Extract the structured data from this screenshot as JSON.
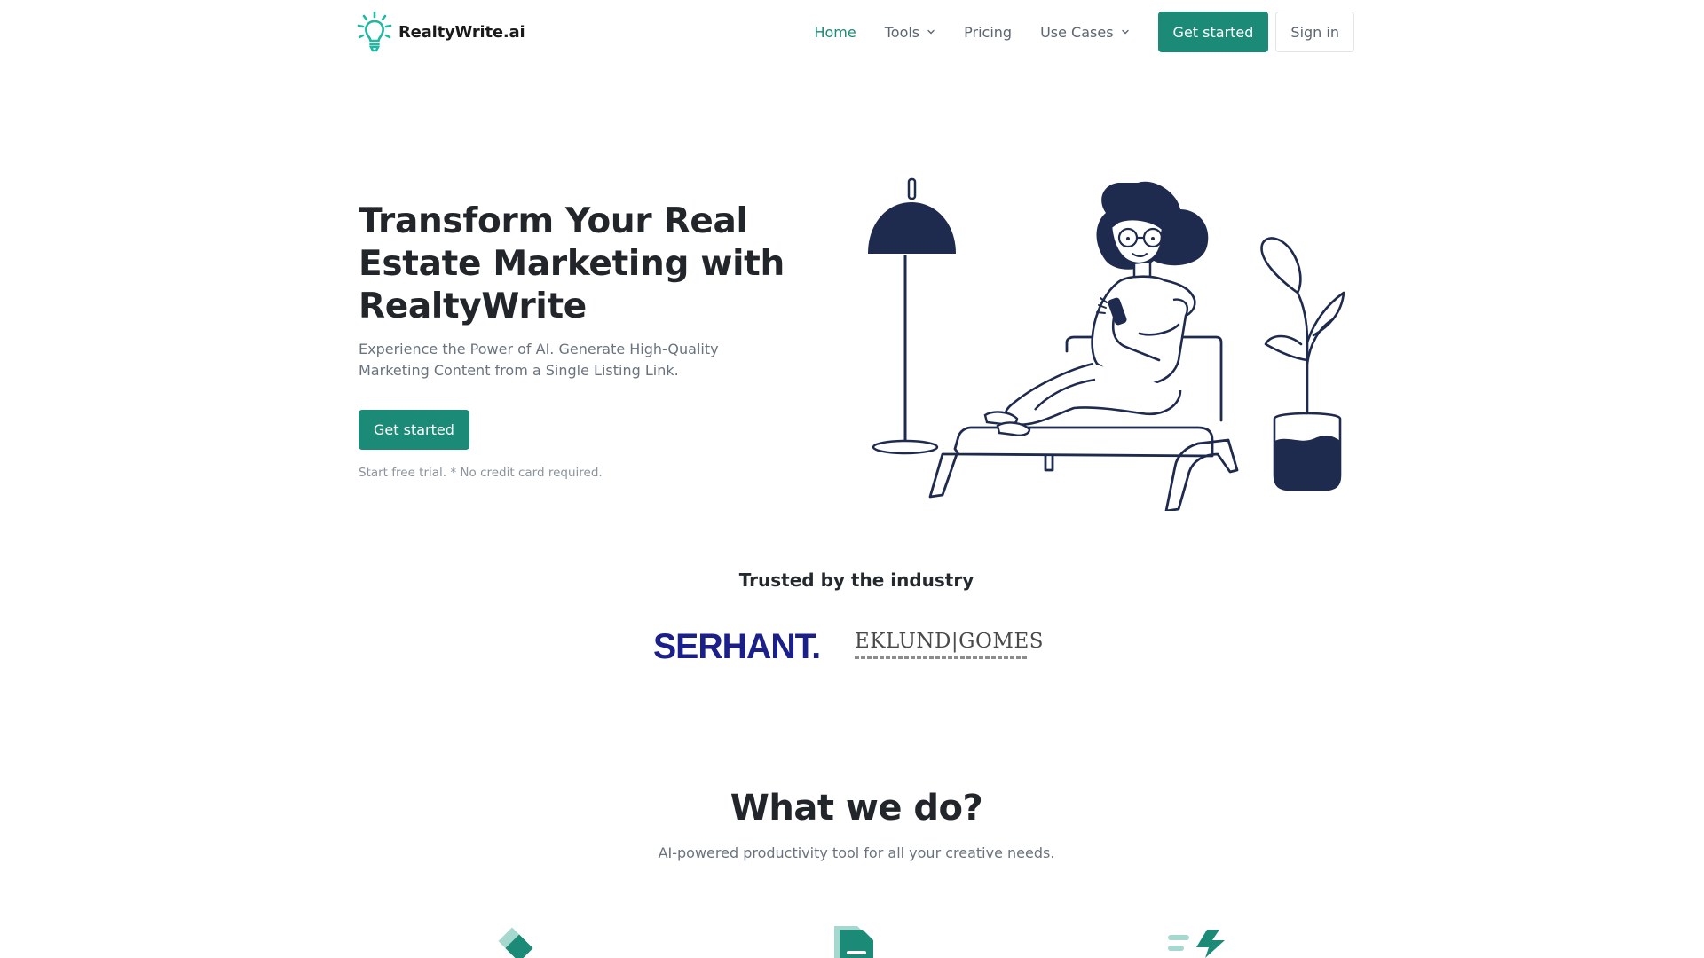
{
  "nav": {
    "logo_text": "RealtyWrite.ai",
    "links": [
      {
        "label": "Home",
        "active": true,
        "has_dropdown": false
      },
      {
        "label": "Tools",
        "active": false,
        "has_dropdown": true
      },
      {
        "label": "Pricing",
        "active": false,
        "has_dropdown": false
      },
      {
        "label": "Use Cases",
        "active": false,
        "has_dropdown": true
      }
    ],
    "get_started_label": "Get started",
    "sign_in_label": "Sign in"
  },
  "hero": {
    "title": "Transform Your Real Estate Marketing with RealtyWrite",
    "subtitle": "Experience the Power of AI. Generate High-Quality Marketing Content from a Single Listing Link.",
    "cta_label": "Get started",
    "note": "Start free trial. * No credit card required."
  },
  "trusted": {
    "title": "Trusted by the industry",
    "brands": [
      "SERHANT.",
      "EKLUND|GOMES"
    ]
  },
  "what_we_do": {
    "title": "What we do?",
    "subtitle": "AI-powered productivity tool for all your creative needs.",
    "feature_icons": [
      "diamond-shapes-icon",
      "document-icon",
      "lightning-bolt-icon"
    ]
  },
  "colors": {
    "accent": "#1b8a76",
    "navy": "#1e2b4f",
    "text": "#22262b",
    "muted": "#6a737d",
    "serhant": "#1b1f8a"
  }
}
